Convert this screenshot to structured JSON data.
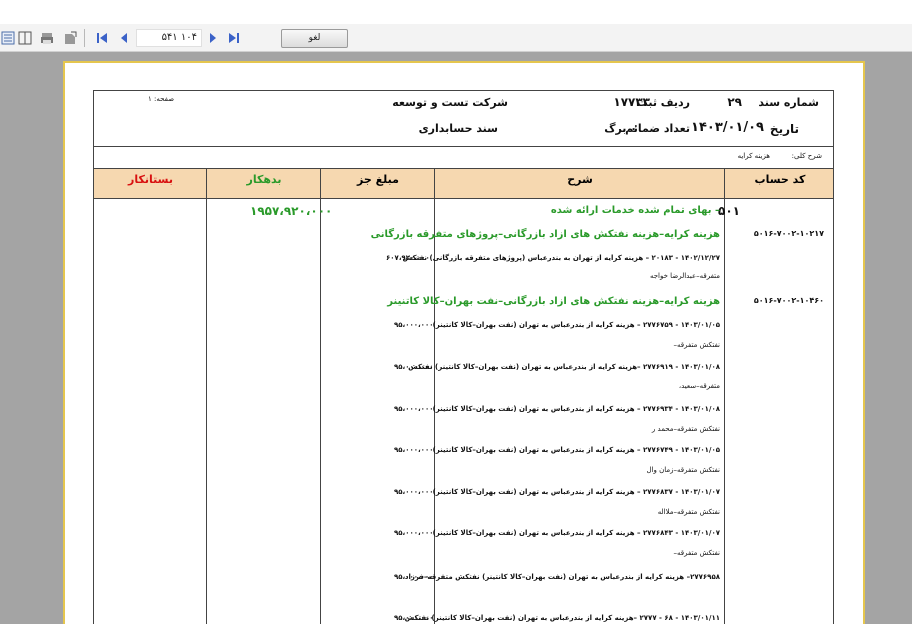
{
  "toolbar": {
    "page_indicator": "۱۰۴ ۵۴۱",
    "cancel_label": "لغو"
  },
  "header": {
    "doc_number_label": "شماره سند",
    "doc_number": "۲۹",
    "reg_row_label": "ردیف ثبت",
    "reg_row": "۱۷۷۳۳",
    "company": "شرکت تست و توسعه",
    "page_label": "صفحه: ۱",
    "date_label": "تاریخ",
    "date": "۱۴۰۳/۰۱/۰۹",
    "attachments_label": "تعداد ضمائم",
    "attachments": "۰ برگ",
    "doc_type": "سند حسابداری"
  },
  "description": {
    "label": "شرح کلی:",
    "value": "هزینه کرایه"
  },
  "columns": {
    "account_code": "کد حساب",
    "description": "شرح",
    "partial_amount": "مبلغ جز",
    "debit": "بدهکار",
    "credit": "بستانکار"
  },
  "rows": {
    "group_code": "۵۰۱",
    "group_title": "– بهای تمام شده خدمات ارائه شده",
    "group_debit": "۱۹۵۷،۹۲۰،۰۰۰",
    "sub1_code": "۵۰۱۶-۷۰۰۲-۱۰۲۱۷",
    "sub1_title": "هزینه کرایه–هزینه نفتکش های ازاد بازرگانی–پروژهای متفرقه بازرگانی",
    "item1_line1": "۱۴۰۲/۱۲/۲۷ - ۲۰۱۸۳ – هزینه کرایه  از تهران به بندرعباس (پروژهای متفرقه بازرگانی) نفتکش",
    "item1_line2": "متفرقه–عبدالرضا خواجه",
    "item1_amount": "۶۰۷،۹۲۰،۰۰۰",
    "sub2_code": "۵۰۱۶-۷۰۰۲-۱۰۴۶۰",
    "sub2_title": "هزینه کرایه–هزینه نفتکش های ازاد بازرگانی–نفت بهران–کالا کاتنینر",
    "item2_line1": "۱۴۰۳/۰۱/۰۵ - ۲۷۷۶۷۵۹ – هزینه کرایه  از بندرعباس به تهران (نفت بهران–کالا کانتینر)",
    "item2_line2": "نفتکش متفرقه–",
    "item2_amount": "۹۵،۰۰۰،۰۰۰",
    "item3_line1": "۱۴۰۳/۰۱/۰۸ - ۲۷۷۶۹۱۹ –هزینه کرایه  از بندرعباس به تهران (نفت بهران–کالا کانتینر) نفتکش",
    "item3_line2": "متفرقه–سعید،",
    "item3_amount": "۹۵،۰۰۰،۰۰۰",
    "item4_line1": "۱۴۰۳/۰۱/۰۸ - ۲۷۷۶۹۳۴ – هزینه کرایه  از بندرعباس به تهران (نفت بهران–کالا کانتینر)",
    "item4_line2": "نفتکش متفرقه–محمد ر",
    "item4_amount": "۹۵،۰۰۰،۰۰۰",
    "item5_line1": "۱۴۰۳/۰۱/۰۵ - ۲۷۷۶۷۴۹ – هزینه کرایه  از بندرعباس به تهران (نفت بهران–کالا کانتینر)",
    "item5_line2": "نفتکش متفرقه–زمان وال",
    "item5_amount": "۹۵،۰۰۰،۰۰۰",
    "item6_line1": "۱۴۰۳/۰۱/۰۷ - ۲۷۷۶۸۳۷ – هزینه کرایه  از بندرعباس به تهران (نفت بهران–کالا کانتینر)",
    "item6_line2": "نفتکش متفرقه–ملااله",
    "item6_amount": "۹۵،۰۰۰،۰۰۰",
    "item7_line1": "۱۴۰۳/۰۱/۰۷ - ۲۷۷۶۸۴۳ – هزینه کرایه  از بندرعباس به تهران (نفت بهران–کالا کانتینر)",
    "item7_line2": "نفتکش متفرقه–",
    "item7_amount": "۹۵،۰۰۰،۰۰۰",
    "item8_line1": "۲۷۷۶۹۵۸– هزینه کرایه  از بندرعباس به تهران (نفت بهران–کالا کانتینر) نفتکش متفرقه–فرزاد",
    "item8_amount": "۹۵،۰۰۰،۰۰۰",
    "item9_line1": "۱۴۰۳/۰۱/۱۱ - ۶۸ - ۲۷۷۷ –هزینه کرایه  از بندرعباس به تهران (نفت بهران–کالا کانتینر) نفتکش",
    "item9_amount": "۹۵،۰۰۰،۰۰۰"
  },
  "colors": {
    "accent_green": "#2a9a2a",
    "accent_red": "#d81010",
    "header_fill": "#f6d8b0",
    "paper_border": "#e5c64e"
  }
}
